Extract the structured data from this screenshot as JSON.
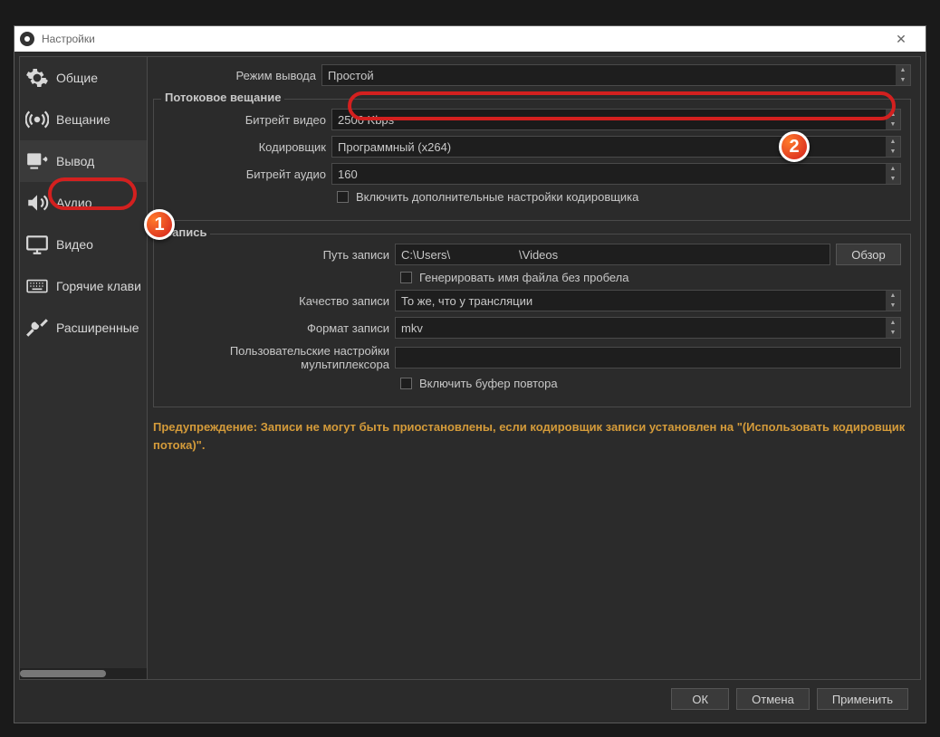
{
  "window": {
    "title": "Настройки"
  },
  "sidebar": {
    "items": [
      {
        "label": "Общие"
      },
      {
        "label": "Вещание"
      },
      {
        "label": "Вывод"
      },
      {
        "label": "Аудио"
      },
      {
        "label": "Видео"
      },
      {
        "label": "Горячие клавиши"
      },
      {
        "label": "Расширенные"
      }
    ]
  },
  "output_mode": {
    "label": "Режим вывода",
    "value": "Простой"
  },
  "streaming": {
    "title": "Потоковое вещание",
    "video_bitrate": {
      "label": "Битрейт видео",
      "value": "2500 Kbps"
    },
    "encoder": {
      "label": "Кодировщик",
      "value": "Программный (x264)"
    },
    "audio_bitrate": {
      "label": "Битрейт аудио",
      "value": "160"
    },
    "adv_encoder_checkbox": "Включить дополнительные настройки кодировщика"
  },
  "recording": {
    "title": "Запись",
    "path": {
      "label": "Путь записи",
      "value": "C:\\Users\\                     \\Videos",
      "browse": "Обзор"
    },
    "no_space_checkbox": "Генерировать имя файла без пробела",
    "quality": {
      "label": "Качество записи",
      "value": "То же, что у трансляции"
    },
    "format": {
      "label": "Формат записи",
      "value": "mkv"
    },
    "muxer": {
      "label": "Пользовательские настройки мультиплексора",
      "value": ""
    },
    "replay_buffer_checkbox": "Включить буфер повтора"
  },
  "warning": "Предупреждение: Записи не могут быть приостановлены, если кодировщик записи установлен на \"(Использовать кодировщик потока)\".",
  "footer": {
    "ok": "ОК",
    "cancel": "Отмена",
    "apply": "Применить"
  },
  "markers": {
    "m1": "1",
    "m2": "2"
  }
}
